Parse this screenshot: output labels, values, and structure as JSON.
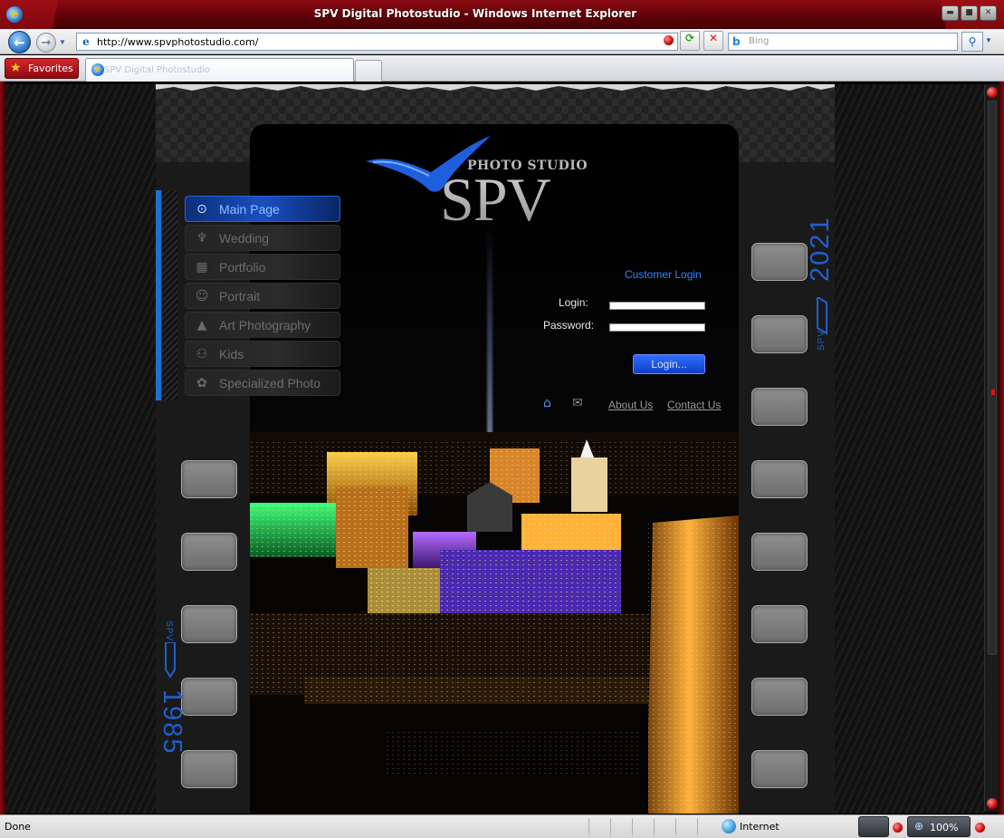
{
  "window": {
    "title": "SPV Digital Photostudio - Windows Internet Explorer",
    "minimize_glyph": "▬",
    "maximize_glyph": "■",
    "close_glyph": "✕"
  },
  "toolbar": {
    "url": "http://www.spvphotostudio.com/",
    "search_placeholder": "Bing",
    "back_glyph": "←",
    "forward_glyph": "→",
    "refresh_glyph": "⟳",
    "stop_glyph": "✕",
    "search_glyph": "⚲"
  },
  "tabs": {
    "favorites_label": "Favorites",
    "active_tab_label": "SPV Digital Photostudio"
  },
  "site": {
    "logo_subtitle": "PHOTO STUDIO",
    "logo_main": "SPV",
    "nav": [
      {
        "label": "Main Page",
        "icon": "⊙",
        "active": true
      },
      {
        "label": "Wedding",
        "icon": "♆",
        "active": false
      },
      {
        "label": "Portfolio",
        "icon": "▦",
        "active": false
      },
      {
        "label": "Portrait",
        "icon": "☺",
        "active": false
      },
      {
        "label": "Art Photography",
        "icon": "▲",
        "active": false
      },
      {
        "label": "Kids",
        "icon": "⚇",
        "active": false
      },
      {
        "label": "Specialized Photo",
        "icon": "✿",
        "active": false
      }
    ],
    "login": {
      "title": "Customer Login",
      "login_label": "Login:",
      "password_label": "Password:",
      "login_value": "",
      "password_value": "",
      "button_label": "Login..."
    },
    "links": {
      "about": "About Us",
      "contact": "Contact Us"
    },
    "year_right": "2021",
    "year_left": "1985",
    "spv_tag": "SPV"
  },
  "status": {
    "text": "Done",
    "zone": "Internet",
    "zoom": "100%"
  },
  "colors": {
    "accent_blue": "#1f5fcf",
    "ie_red": "#8a0b12",
    "login_link": "#2f86ff"
  }
}
